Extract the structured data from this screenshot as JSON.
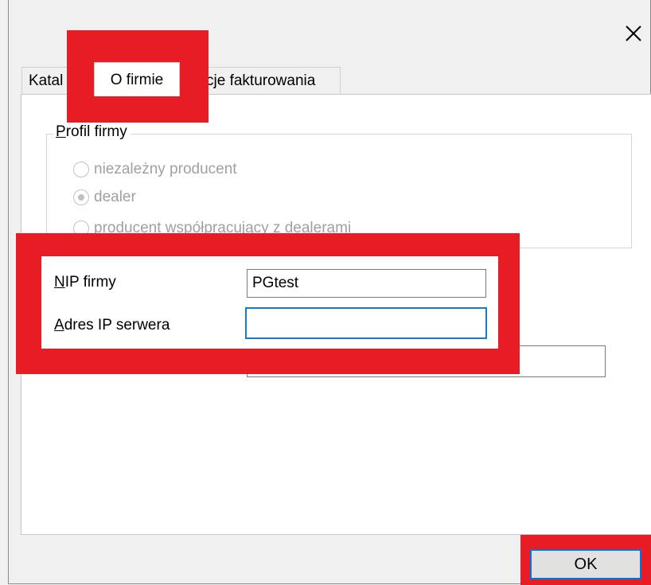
{
  "window": {
    "close_glyph": "close-icon"
  },
  "tabs": [
    {
      "label": "Katal",
      "visible_partial": true
    },
    {
      "label": "O firmie"
    },
    {
      "label": "cje fakturowania",
      "visible_partial": true
    }
  ],
  "profile": {
    "title_first": "P",
    "title_rest": "rofil firmy",
    "options": [
      {
        "label": "niezależny producent",
        "checked": false
      },
      {
        "label": "dealer",
        "checked": true
      },
      {
        "label": "producent współpracujący z dealerami",
        "checked": false
      }
    ]
  },
  "fields": {
    "nip_label_first": "N",
    "nip_label_rest": "IP firmy",
    "nip_value": "PGtest",
    "ip_label_first": "A",
    "ip_label_rest": "dres IP serwera",
    "ip_value": ""
  },
  "buttons": {
    "ok_label": "OK"
  },
  "colors": {
    "highlight": "#e81c24",
    "focus": "#1979ca"
  }
}
